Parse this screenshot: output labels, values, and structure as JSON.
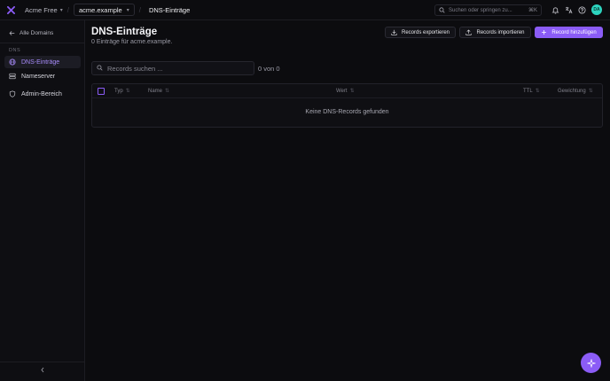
{
  "topbar": {
    "team_name": "Acme Free",
    "domain_value": "acme.example",
    "current_page": "DNS-Einträge",
    "search_placeholder": "Suchen oder springen zu...",
    "search_shortcut": "⌘K",
    "avatar_initials": "DA"
  },
  "sidebar": {
    "back_label": "Alle Domains",
    "section_label": "DNS",
    "items": [
      {
        "label": "DNS-Einträge",
        "icon": "globe-icon",
        "active": true
      },
      {
        "label": "Nameserver",
        "icon": "server-icon",
        "active": false
      },
      {
        "label": "Admin-Bereich",
        "icon": "shield-icon",
        "active": false
      }
    ]
  },
  "main": {
    "title": "DNS-Einträge",
    "subtitle": "0 Einträge für acme.example.",
    "buttons": {
      "export": "Records exportieren",
      "import": "Records importieren",
      "add": "Record hinzufügen"
    },
    "records_search_placeholder": "Records suchen ...",
    "count": "0 von 0",
    "table": {
      "columns": [
        "Typ",
        "Name",
        "Wert",
        "TTL",
        "Gewichtung"
      ],
      "empty_text": "Keine DNS-Records gefunden"
    }
  },
  "colors": {
    "accent": "#8b5cf6",
    "background": "#0c0c0f",
    "avatar": "#2dd4bf"
  }
}
